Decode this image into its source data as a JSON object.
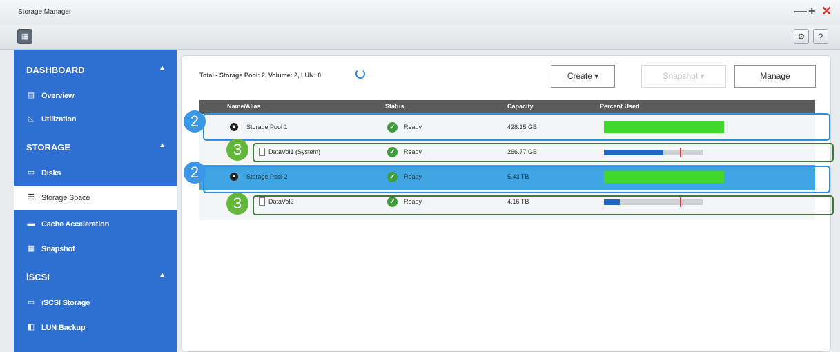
{
  "window": {
    "title": "Storage Manager",
    "controls": {
      "minimize": "—",
      "maximize": "+",
      "close": "✕"
    }
  },
  "toolbar": {
    "settings_icon": "gear-icon",
    "help_label": "?"
  },
  "sidebar": {
    "sections": [
      {
        "title": "DASHBOARD",
        "items": [
          {
            "label": "Overview",
            "icon": "overview-icon"
          },
          {
            "label": "Utilization",
            "icon": "chart-icon"
          }
        ]
      },
      {
        "title": "STORAGE",
        "items": [
          {
            "label": "Disks",
            "icon": "disk-icon"
          },
          {
            "label": "Storage Space",
            "icon": "storage-icon",
            "active": true
          },
          {
            "label": "Cache Acceleration",
            "icon": "cache-icon"
          },
          {
            "label": "Snapshot",
            "icon": "snapshot-icon"
          }
        ]
      },
      {
        "title": "iSCSI",
        "items": [
          {
            "label": "iSCSI Storage",
            "icon": "iscsi-icon"
          },
          {
            "label": "LUN Backup",
            "icon": "backup-icon"
          }
        ]
      }
    ]
  },
  "main": {
    "summary": "Total - Storage Pool: 2, Volume: 2, LUN: 0",
    "buttons": {
      "create": "Create ▾",
      "snapshot": "Snapshot ▾",
      "manage": "Manage"
    },
    "table": {
      "headers": [
        "Name/Alias",
        "Status",
        "Capacity",
        "Percent Used"
      ],
      "rows": [
        {
          "name": "Storage Pool 1",
          "status": "Ready",
          "capacity": "428.15 GB",
          "type": "pool",
          "percent_used": 1.0
        },
        {
          "name": "DataVol1 (System)",
          "status": "Ready",
          "capacity": "266.77 GB",
          "type": "volume",
          "percent_used": 0.6,
          "threshold": 0.77
        },
        {
          "name": "Storage Pool 2",
          "status": "Ready",
          "capacity": "5.43 TB",
          "type": "pool",
          "selected": true,
          "percent_used": 1.0
        },
        {
          "name": "DataVol2",
          "status": "Ready",
          "capacity": "4.16 TB",
          "type": "volume",
          "percent_used": 0.16,
          "threshold": 0.77
        }
      ]
    }
  },
  "callouts": {
    "pool_badge": "2",
    "volume_badge": "3"
  },
  "colors": {
    "sidebar_bg": "#2e6fd1",
    "selected_row": "#3fa6e3",
    "pool_bar": "#41d62b",
    "volume_bar": "#1f63c4",
    "ok_icon": "#3e9f3a"
  }
}
